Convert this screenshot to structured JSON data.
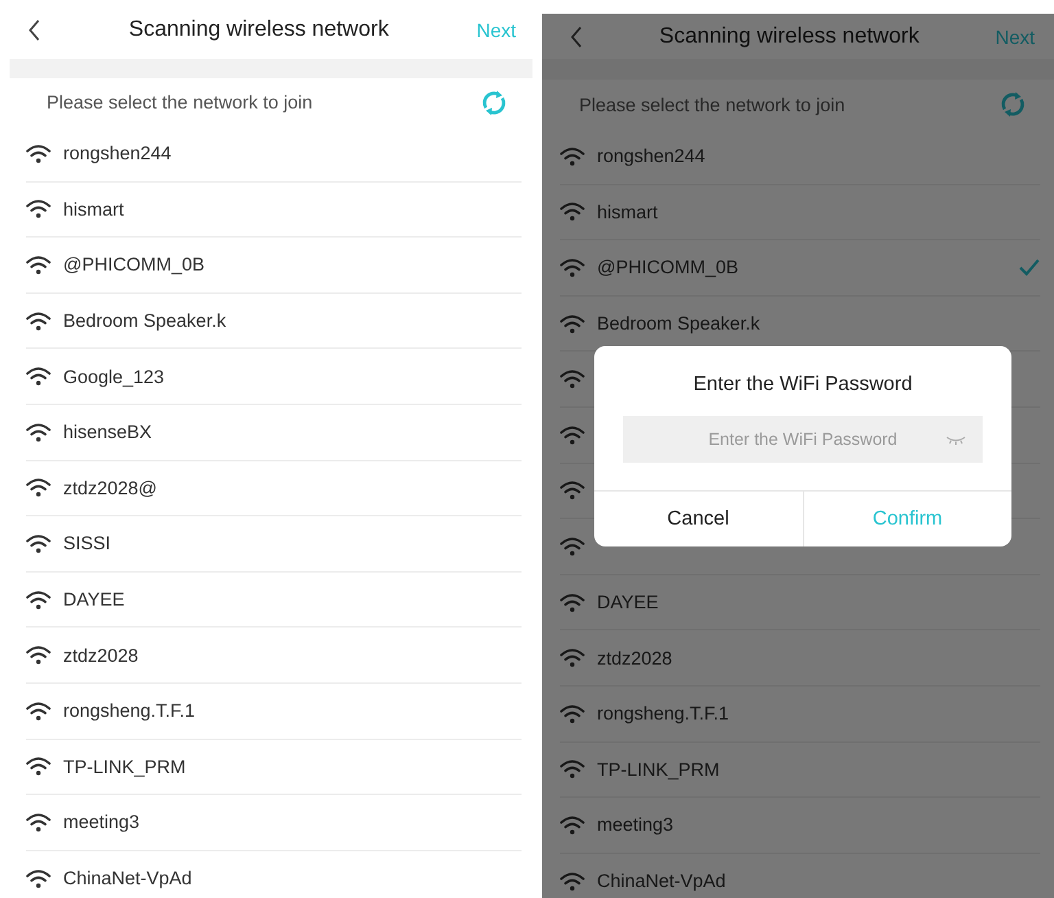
{
  "screens": [
    {
      "title": "Scanning wireless network",
      "action": "Next",
      "prompt": "Please select the network to join",
      "networks": [
        {
          "name": "rongshen244",
          "selected": false
        },
        {
          "name": "hismart",
          "selected": false
        },
        {
          "name": "@PHICOMM_0B",
          "selected": false
        },
        {
          "name": "Bedroom Speaker.k",
          "selected": false
        },
        {
          "name": "Google_123",
          "selected": false
        },
        {
          "name": "hisenseBX",
          "selected": false
        },
        {
          "name": "ztdz2028@",
          "selected": false
        },
        {
          "name": "SISSI",
          "selected": false
        },
        {
          "name": "DAYEE",
          "selected": false
        },
        {
          "name": "ztdz2028",
          "selected": false
        },
        {
          "name": "rongsheng.T.F.1",
          "selected": false
        },
        {
          "name": "TP-LINK_PRM",
          "selected": false
        },
        {
          "name": "meeting3",
          "selected": false
        },
        {
          "name": "ChinaNet-VpAd",
          "selected": false
        }
      ]
    },
    {
      "title": "Scanning wireless network",
      "action": "Next",
      "prompt": "Please select the network to join",
      "networks": [
        {
          "name": "rongshen244",
          "selected": false
        },
        {
          "name": "hismart",
          "selected": false
        },
        {
          "name": "@PHICOMM_0B",
          "selected": true
        },
        {
          "name": "Bedroom Speaker.k",
          "selected": false
        },
        {
          "selected": false
        },
        {
          "selected": false
        },
        {
          "selected": false
        },
        {
          "selected": false
        },
        {
          "name": "DAYEE",
          "selected": false
        },
        {
          "name": "ztdz2028",
          "selected": false
        },
        {
          "name": "rongsheng.T.F.1",
          "selected": false
        },
        {
          "name": "TP-LINK_PRM",
          "selected": false
        },
        {
          "name": "meeting3",
          "selected": false
        },
        {
          "name": "ChinaNet-VpAd",
          "selected": false
        }
      ],
      "dialog": {
        "title": "Enter the WiFi Password",
        "placeholder": "Enter the WiFi Password",
        "cancel": "Cancel",
        "confirm": "Confirm"
      }
    }
  ]
}
